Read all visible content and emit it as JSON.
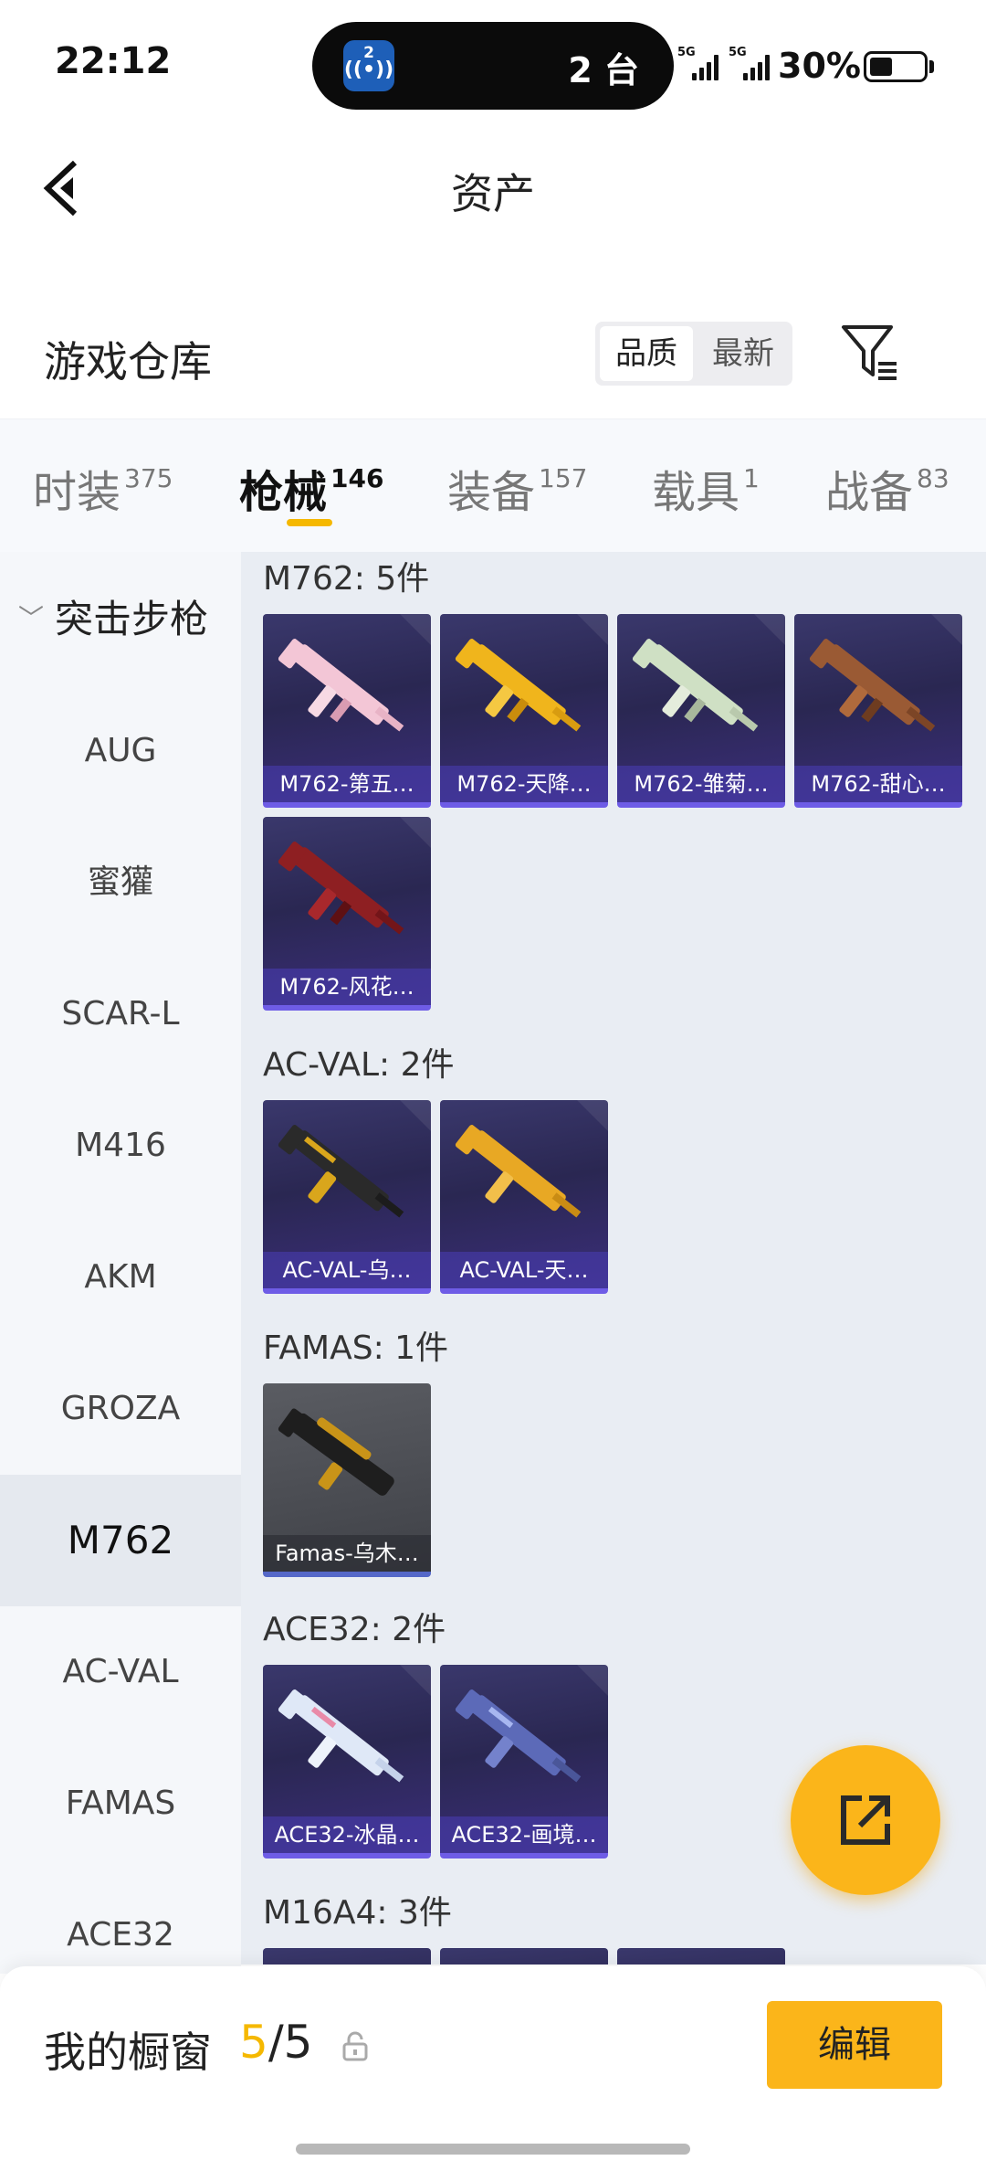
{
  "status_bar": {
    "time": "22:12",
    "island_icon_number": "2",
    "island_text": "2 台",
    "network1": "5G",
    "network2": "5G",
    "battery": "30%"
  },
  "header": {
    "title": "资产"
  },
  "warehouse": {
    "title": "游戏仓库",
    "sort_quality": "品质",
    "sort_latest": "最新"
  },
  "tabs": [
    {
      "label": "时装",
      "count": "375"
    },
    {
      "label": "枪械",
      "count": "146"
    },
    {
      "label": "装备",
      "count": "157"
    },
    {
      "label": "载具",
      "count": "1"
    },
    {
      "label": "战备",
      "count": "83"
    }
  ],
  "sidebar": {
    "heading": "突击步枪",
    "items": [
      "AUG",
      "蜜獾",
      "SCAR-L",
      "M416",
      "AKM",
      "GROZA",
      "M762",
      "AC-VAL",
      "FAMAS",
      "ACE32"
    ]
  },
  "groups": [
    {
      "title": "M762: 5件",
      "items": [
        "M762-第五…",
        "M762-天降…",
        "M762-雏菊…",
        "M762-甜心…",
        "M762-风花…"
      ]
    },
    {
      "title": "AC-VAL: 2件",
      "items": [
        "AC-VAL-乌…",
        "AC-VAL-天…"
      ]
    },
    {
      "title": "FAMAS: 1件",
      "items": [
        "Famas-乌木…"
      ]
    },
    {
      "title": "ACE32: 2件",
      "items": [
        "ACE32-冰晶…",
        "ACE32-画境…"
      ]
    },
    {
      "title": "M16A4: 3件",
      "items": [
        "",
        "",
        ""
      ]
    }
  ],
  "bottom": {
    "showcase_label": "我的橱窗",
    "showcase_current": "5",
    "showcase_sep_total": "/5",
    "edit_label": "编辑"
  },
  "colors": {
    "accent": "#fbb51a",
    "tab_underline": "#f5b800",
    "card_bg": "#2a2752",
    "card_border": "#6e5ce6"
  }
}
